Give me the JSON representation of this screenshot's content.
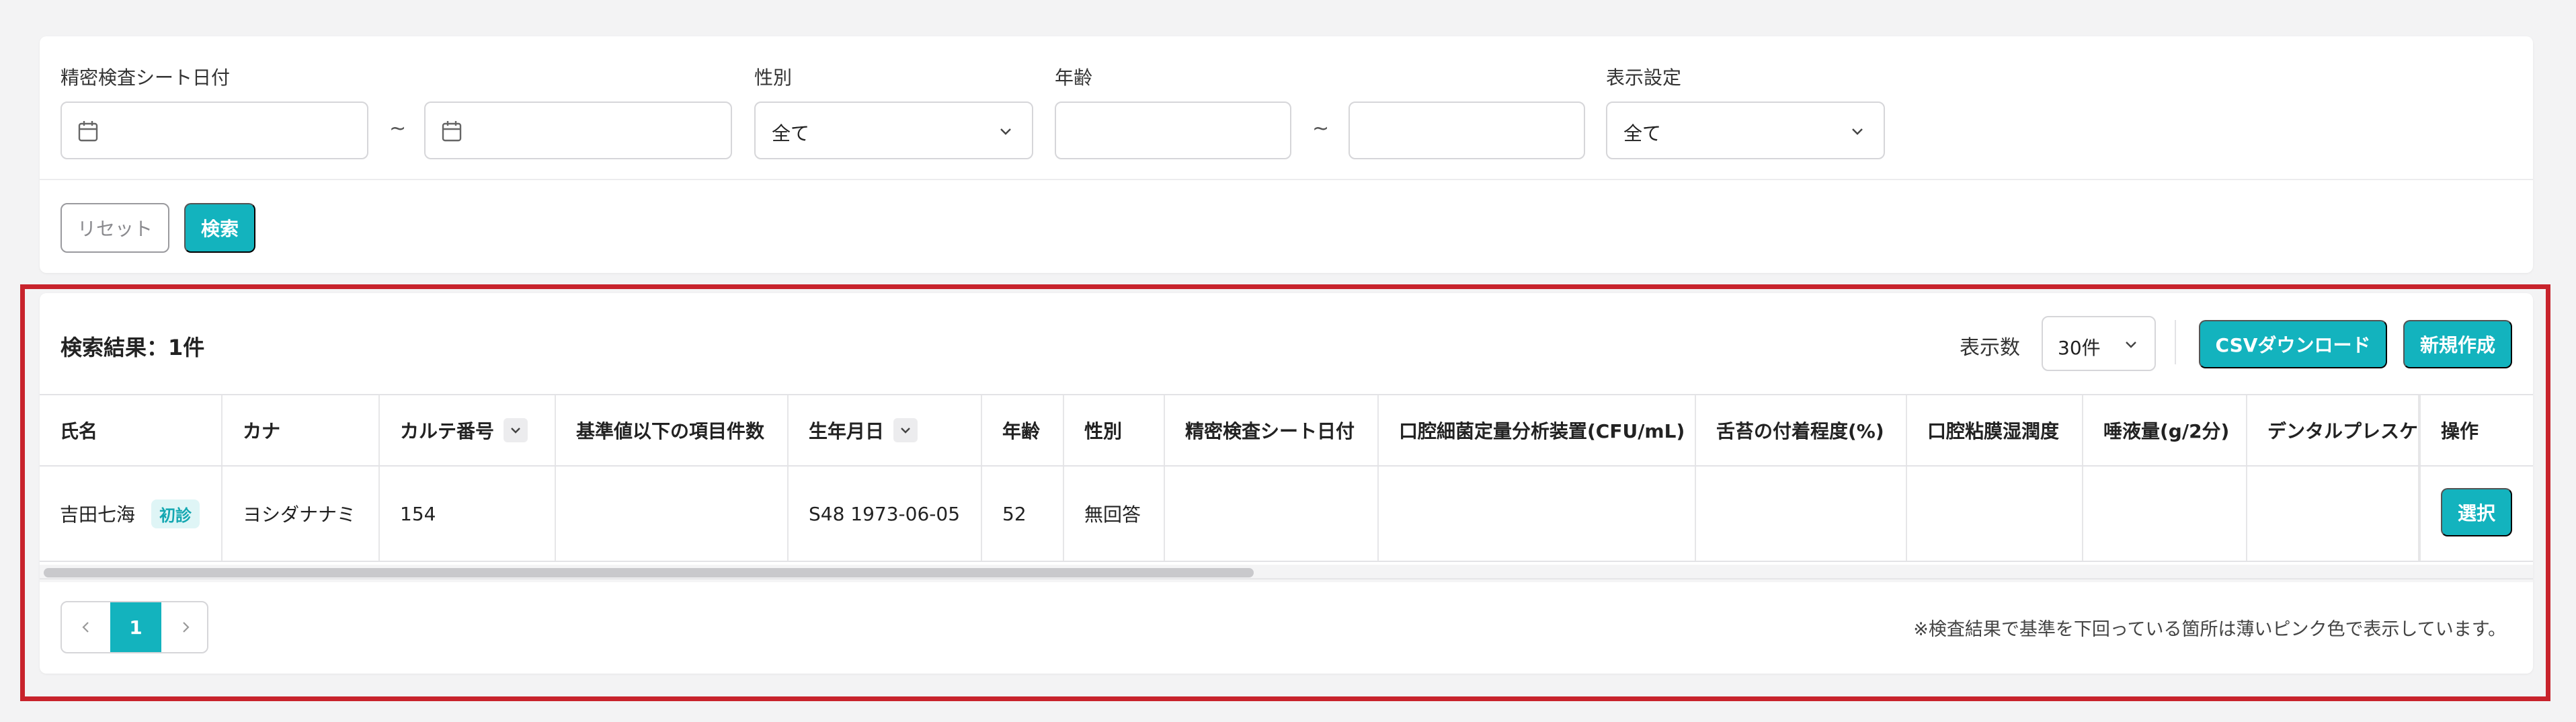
{
  "filters": {
    "date_label": "精密検査シート日付",
    "date_from": "",
    "date_to": "",
    "range_separator": "~",
    "gender_label": "性別",
    "gender_value": "全て",
    "age_label": "年齢",
    "age_from": "",
    "age_to": "",
    "display_label": "表示設定",
    "display_value": "全て",
    "reset_label": "リセット",
    "search_label": "検索"
  },
  "results": {
    "title": "検索結果：1件",
    "perpage_label": "表示数",
    "perpage_value": "30件",
    "csv_label": "CSVダウンロード",
    "new_label": "新規作成"
  },
  "table": {
    "headers": [
      "氏名",
      "カナ",
      "カルテ番号",
      "基準値以下の項目件数",
      "生年月日",
      "年齢",
      "性別",
      "精密検査シート日付",
      "口腔細菌定量分析装置(CFU/mL)",
      "舌苔の付着程度(%)",
      "口腔粘膜湿潤度",
      "唾液量(g/2分)",
      "デンタルプレスケール",
      "操作"
    ],
    "row": {
      "name": "吉田七海",
      "badge": "初診",
      "kana": "ヨシダナナミ",
      "chart_no": "154",
      "below_count": "",
      "birthdate": "S48 1973-06-05",
      "age": "52",
      "gender": "無回答",
      "sheet_date": "",
      "cfu": "",
      "tongue": "",
      "mucosa": "",
      "saliva": "",
      "dental": "",
      "action_label": "選択"
    }
  },
  "pagination": {
    "current": "1"
  },
  "footnote": "※検査結果で基準を下回っている箇所は薄いピンク色で表示しています。",
  "colors": {
    "accent": "#13b3be",
    "highlight_frame": "#c8232c",
    "badge_bg": "#dff5f6"
  }
}
